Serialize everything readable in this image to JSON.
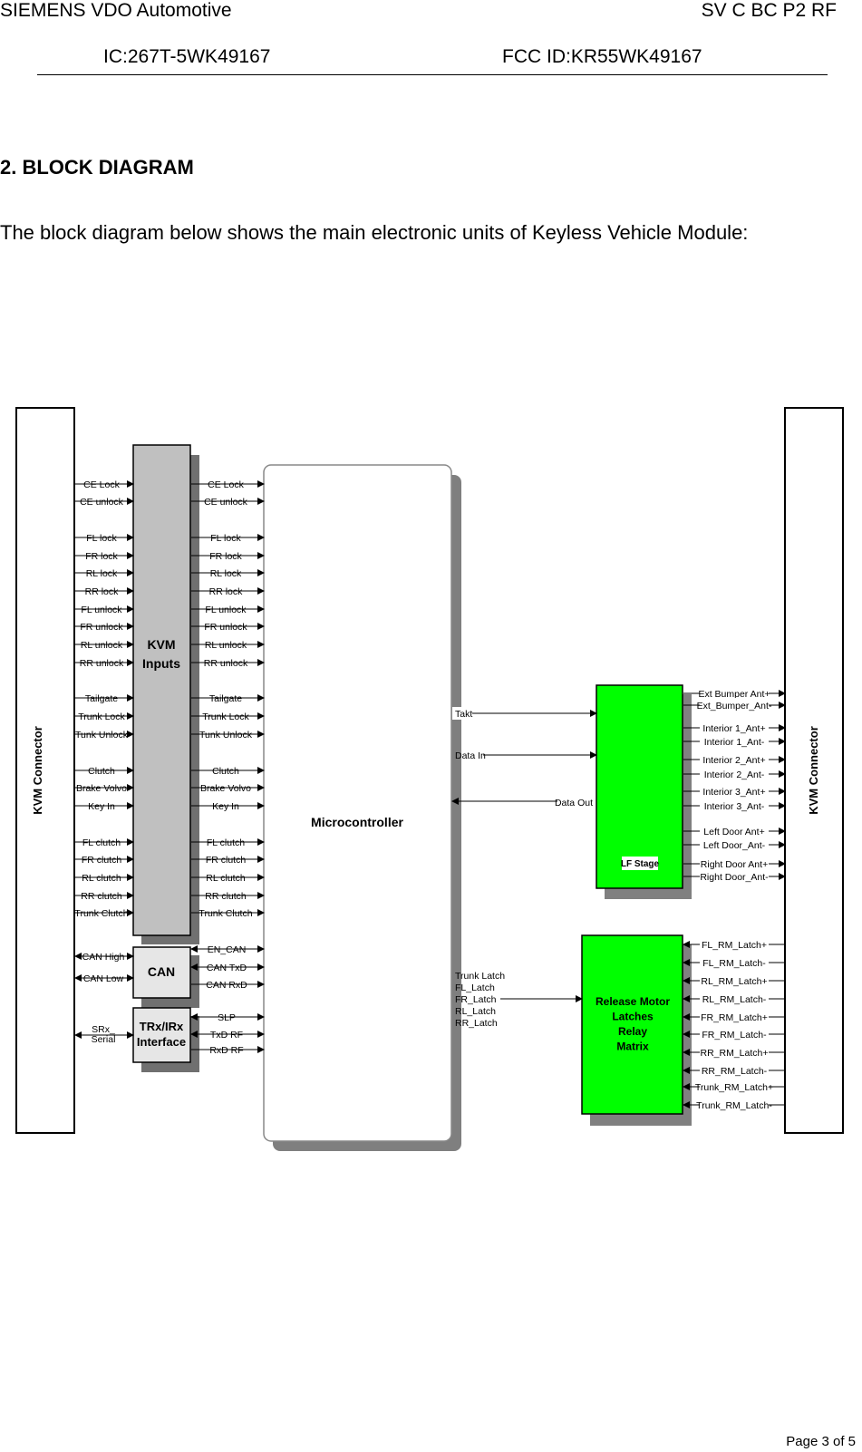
{
  "header": {
    "company": "SIEMENS VDO Automotive",
    "doc_code": "SV C BC P2 RF",
    "ic_id": "IC:267T-5WK49167",
    "fcc_id": "FCC ID:KR55WK49167"
  },
  "section": {
    "heading": "2. BLOCK DIAGRAM",
    "intro": "The block diagram below shows the main electronic units of Keyless Vehicle Module:"
  },
  "diagram": {
    "colors": {
      "green_block": "#00ff00",
      "gray_block": "#c0c0c0",
      "light_block": "#e6e6e6",
      "shadow": "#707070"
    },
    "left_connector": "KVM Connector",
    "right_connector": "KVM Connector",
    "kvm_inputs": [
      "KVM",
      "Inputs"
    ],
    "can_block": "CAN",
    "trx_block": [
      "TRx/IRx",
      "Interface"
    ],
    "microcontroller": "Microcontroller",
    "lf_stage": "LF Stage",
    "release_block": [
      "Release Motor",
      "Latches",
      "Relay",
      "Matrix"
    ],
    "input_signals": [
      "CE Lock",
      "CE unlock",
      "FL lock",
      "FR lock",
      "RL lock",
      "RR lock",
      "FL unlock",
      "FR unlock",
      "RL unlock",
      "RR unlock",
      "Tailgate",
      "Trunk Lock",
      "Tunk Unlock",
      "Clutch",
      "Brake Volvo",
      "Key In",
      "FL clutch",
      "FR  clutch",
      "RL clutch",
      "RR clutch",
      "Trunk Clutch"
    ],
    "can_left_signals": [
      "CAN High",
      "CAN Low"
    ],
    "can_right_signals": [
      "EN_CAN",
      "CAN TxD",
      "CAN RxD"
    ],
    "trx_left_signal": [
      "SRx_",
      "Serial"
    ],
    "trx_right_signals": [
      "SLP",
      "TxD RF",
      "RxD RF"
    ],
    "lf_in_signals": [
      "Takt",
      "Data In"
    ],
    "lf_out_signal": "Data Out",
    "latch_signals": [
      "Trunk Latch",
      "FL_Latch",
      "FR_Latch",
      "RL_Latch",
      "RR_Latch"
    ],
    "antenna_signals": [
      "Ext  Bumper  Ant+",
      "Ext_Bumper_Ant-",
      "Interior 1_Ant+",
      "Interior 1_Ant-",
      "Interior 2_Ant+",
      "Interior 2_Ant-",
      "Interior 3_Ant+",
      "Interior 3_Ant-",
      "Left Door  Ant+",
      "Left Door_Ant-",
      "Right Door  Ant+",
      "Right Door_Ant-"
    ],
    "rm_latch_signals": [
      "FL_RM_Latch+",
      "FL_RM_Latch-",
      "RL_RM_Latch+",
      "RL_RM_Latch-",
      "FR_RM_Latch+",
      "FR_RM_Latch-",
      "RR_RM_Latch+",
      "RR_RM_Latch-",
      "Trunk_RM_Latch+",
      "Trunk_RM_Latch-"
    ]
  },
  "footer": {
    "page": "Page 3 of 5"
  }
}
